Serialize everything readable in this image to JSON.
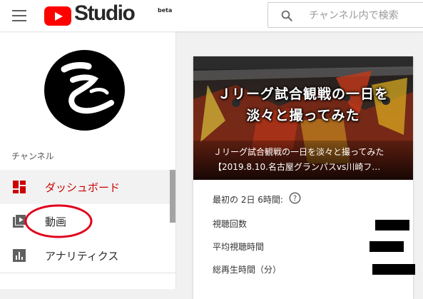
{
  "header": {
    "logo_text": "Studio",
    "logo_badge": "beta",
    "search_placeholder": "チャンネル内で検索"
  },
  "sidebar": {
    "section_label": "チャンネル",
    "items": [
      {
        "label": "ダッシュボード",
        "icon": "dashboard-icon",
        "active": true
      },
      {
        "label": "動画",
        "icon": "video-library-icon",
        "active": false
      },
      {
        "label": "アナリティクス",
        "icon": "analytics-icon",
        "active": false
      }
    ],
    "active_color": "#cc0000",
    "annotation_color": "#e0001b"
  },
  "card": {
    "thumbnail_title_line1": "Ｊリーグ試合観戦の一日を",
    "thumbnail_title_line2": "淡々と撮ってみた",
    "video_title": "Ｊリーグ試合観戦の一日を淡々と撮ってみた【2019.8.10.名古屋グランパスvs川崎フ…",
    "stats_header": "最初の 2日 6時間:",
    "stats": [
      {
        "label": "視聴回数"
      },
      {
        "label": "平均視聴時間"
      },
      {
        "label": "総再生時間（分）"
      }
    ]
  },
  "colors": {
    "youtube_red": "#ff0000",
    "redaction": "#000000"
  }
}
